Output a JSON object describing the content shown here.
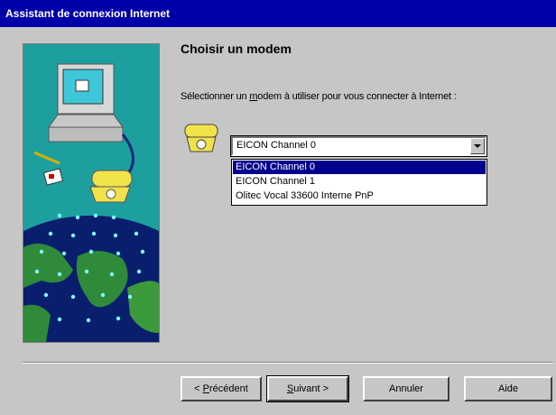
{
  "window": {
    "title": "Assistant de connexion Internet"
  },
  "page": {
    "heading": "Choisir un modem",
    "instruction_pre": "Sélectionner un ",
    "instruction_access": "m",
    "instruction_post": "odem à utiliser pour vous connecter à Internet :"
  },
  "modem_select": {
    "value": "EICON Channel 0",
    "options": [
      {
        "label": "EICON Channel 0",
        "selected": true
      },
      {
        "label": "EICON Channel 1",
        "selected": false
      },
      {
        "label": "Olitec Vocal 33600 Interne PnP",
        "selected": false
      }
    ]
  },
  "buttons": {
    "back_access": "P",
    "back_rest": "récédent",
    "next_access": "S",
    "next_rest": "uivant >",
    "cancel": "Annuler",
    "help": "Aide"
  },
  "colors": {
    "titlebar": "#0000a8",
    "selection": "#00008c",
    "dialog": "#c6c6c6"
  }
}
